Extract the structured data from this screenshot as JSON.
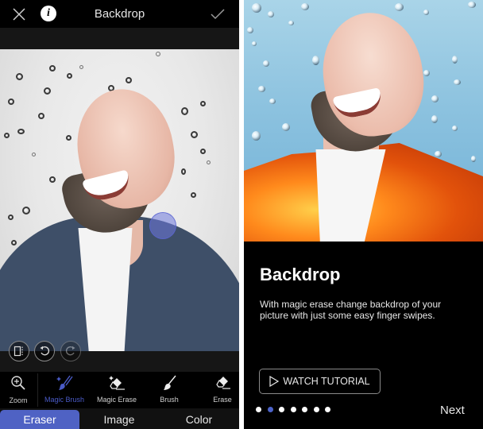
{
  "editor": {
    "header": {
      "title": "Backdrop",
      "close_icon": "close-icon",
      "info_icon": "info-icon",
      "info_glyph": "i",
      "confirm_icon": "checkmark-icon"
    },
    "canvas_controls": {
      "compare_icon": "split-compare-icon",
      "undo_icon": "undo-icon",
      "redo_icon": "redo-icon",
      "contrast_icon": "contrast-toggle-icon"
    },
    "tools": [
      {
        "label": "Zoom",
        "icon": "zoom-in-icon",
        "active": false
      },
      {
        "label": "Magic Brush",
        "icon": "magic-brush-icon",
        "active": true
      },
      {
        "label": "Magic Erase",
        "icon": "magic-erase-icon",
        "active": false
      },
      {
        "label": "Brush",
        "icon": "brush-icon",
        "active": false
      },
      {
        "label": "Erase",
        "icon": "eraser-icon",
        "active": false
      }
    ],
    "tabs": [
      {
        "label": "Eraser",
        "active": true
      },
      {
        "label": "Image",
        "active": false
      },
      {
        "label": "Color",
        "active": false
      }
    ],
    "accent_color": "#4f62c4"
  },
  "onboarding": {
    "title": "Backdrop",
    "description": "With magic erase change backdrop of your picture with just some easy finger swipes.",
    "watch_button": {
      "label": "WATCH TUTORIAL",
      "icon": "play-icon"
    },
    "pager": {
      "total": 7,
      "current": 2
    },
    "next_label": "Next",
    "accent_color": "#4c63c9"
  }
}
